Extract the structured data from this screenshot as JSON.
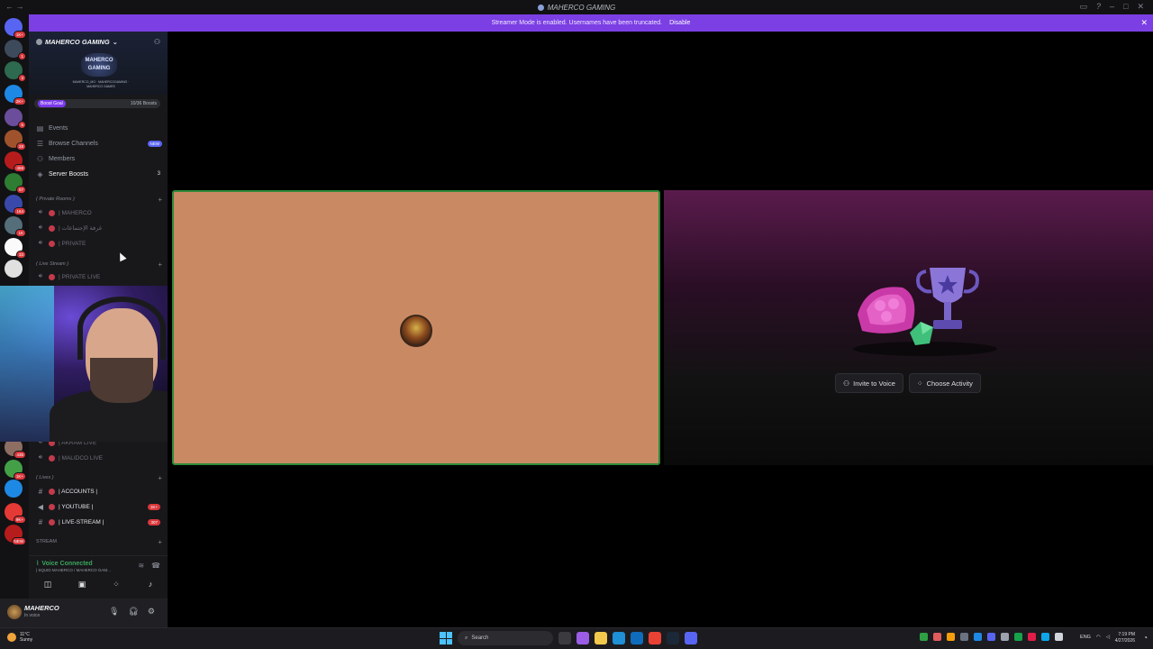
{
  "titlebar": {
    "title": "MAHERCO GAMING"
  },
  "banner": {
    "text": "Streamer Mode is enabled. Usernames have been truncated.",
    "action": "Disable"
  },
  "rail": {
    "servers": [
      {
        "badge": "1K+",
        "color": "#5865f2"
      },
      {
        "badge": "1",
        "color": "#3d4a5c"
      },
      {
        "badge": "3",
        "color": "#2d6a4f"
      },
      {
        "badge": "2K+",
        "color": "#1e88e5"
      },
      {
        "badge": "5",
        "color": "#6b4e9b"
      },
      {
        "badge": "28",
        "color": "#a0522d"
      },
      {
        "badge": "468",
        "color": "#b71c1c"
      },
      {
        "badge": "97",
        "color": "#2e7d32"
      },
      {
        "badge": "164",
        "color": "#3949ab"
      },
      {
        "badge": "1K",
        "color": "#546e7a"
      },
      {
        "badge": "33",
        "color": "#fafafa"
      },
      {
        "badge": "",
        "color": "#e0e0e0"
      }
    ],
    "lower": [
      {
        "badge": "435",
        "color": "#8d6e63"
      },
      {
        "badge": "1K+",
        "color": "#43a047"
      },
      {
        "badge": "",
        "color": "#1e88e5"
      },
      {
        "badge": "9K+",
        "color": "#e53935"
      },
      {
        "badge": "NEW",
        "color": "#b71c1c"
      }
    ]
  },
  "server": {
    "name": "MAHERCO GAMING",
    "logo_text": "MAHERCO GAMING",
    "tagline": "MAHERCO_MG · MAHERCOGAMING · MAHERCO GAMES",
    "boost": {
      "label": "Boost Goal",
      "count": "10/36 Boosts"
    }
  },
  "nav": [
    {
      "label": "Events",
      "icon": "calendar-icon"
    },
    {
      "label": "Browse Channels",
      "icon": "browse-icon",
      "badge": "NEW"
    },
    {
      "label": "Members",
      "icon": "members-icon"
    },
    {
      "label": "Server Boosts",
      "icon": "boost-icon",
      "count": "3"
    }
  ],
  "categories": {
    "private": "( Private Rooms )",
    "live": "( Live Stream )",
    "lives": "( Lives )",
    "stream": "STREAM"
  },
  "channels": {
    "private": [
      "| MAHERCO",
      "| غرفة الإجتماعات",
      "| PRIVATE"
    ],
    "live": [
      "| PRIVATE LIVE"
    ],
    "voice_more": [
      "| AKRAM LIVE",
      "| MALIDCO LIVE"
    ],
    "lives": [
      {
        "label": "| ACCOUNTS |",
        "kind": "text",
        "badge": ""
      },
      {
        "label": "| YOUTUBE |",
        "kind": "announce",
        "badge": "1K+"
      },
      {
        "label": "| LIVE-STREAM |",
        "kind": "text",
        "badge": "307"
      }
    ]
  },
  "voice": {
    "status": "Voice Connected",
    "sub": "| SQUID MAHERCO / MAHERCO GAM..."
  },
  "user": {
    "name": "MAHERCO",
    "status": "In voice"
  },
  "stage": {
    "invite_button": "Invite to Voice",
    "activity_button": "Choose Activity"
  },
  "taskbar": {
    "temp": "11°C",
    "weather": "Sunny",
    "search_placeholder": "Search",
    "lang": "ENG",
    "time": "7:19 PM",
    "date": "4/27/2026"
  }
}
